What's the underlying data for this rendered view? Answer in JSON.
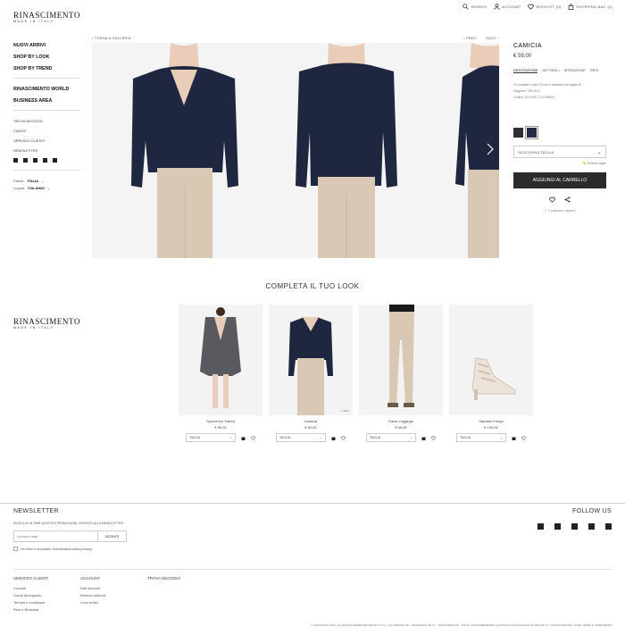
{
  "brand": {
    "name": "RINASCIMENTO",
    "tagline": "MADE IN ITALY"
  },
  "topnav": {
    "search": "SEARCH",
    "account": "ACCOUNT",
    "wishlist": "WISHLIST",
    "wishlist_count": "(0)",
    "bag": "SHOPPING BAG",
    "bag_count": "(0)"
  },
  "sidebar": {
    "primary": [
      "NUOVI ARRIVI",
      "SHOP BY LOOK",
      "SHOP BY TREND"
    ],
    "secondary": [
      "RINASCIMENTO WORLD",
      "BUSINESS AREA"
    ],
    "links": [
      "TROVA NEGOZIO",
      "CARDS",
      "SERVIZIO CLIENTI",
      "NEWSLETTER"
    ],
    "country_label": "Paese:",
    "country_value": "ITALIA",
    "language_label": "Lingua:",
    "language_value": "ITALIANO"
  },
  "gallery": {
    "back_link": "TORNA A GALLERIA",
    "prev": "PREC",
    "next": "SUCC"
  },
  "product": {
    "name": "CAMICIA",
    "price": "€ 59,00",
    "tabs": [
      "DESCRIZIONE",
      "DETTAGLI",
      "SPEDIZIONE",
      "RESI"
    ],
    "description": "La modella è alta 175 cm e indossa una taglia 42.",
    "season": "Stagione: FW 2017",
    "code": "Codice: CFC0017713 003814",
    "size_select": "SELEZIONA TAGLIA",
    "size_guide": "Schede taglie",
    "add_to_cart": "AGGIUNGI AL CARRELLO",
    "question": "Ti possiamo aiutare?",
    "colors": [
      "#2e2e33",
      "#232a45"
    ]
  },
  "look": {
    "title": "COMPLETA IL TUO LOOK",
    "size_label": "TAGLIA",
    "more_label": "+ VEDI",
    "items": [
      {
        "name": "Spolverino Tweed",
        "price": "€ 99,00"
      },
      {
        "name": "Camicia",
        "price": "€ 59,00"
      },
      {
        "name": "Pants Leggings",
        "price": "€ 69,00"
      },
      {
        "name": "Sandalo Pongo",
        "price": "€ 139,00"
      }
    ]
  },
  "footer": {
    "newsletter_title": "NEWSLETTER",
    "newsletter_text": "RICEVI LE ULTIME NOVITÀ E PROMOZIONI, ISCRIVITI ALLA NEWSLETTER",
    "email_placeholder": "La tua e-mail",
    "subscribe": "ISCRIVITI",
    "privacy": "Ho letto e accettato l'informativa sulla privacy",
    "follow_title": "FOLLOW US",
    "columns": [
      {
        "title": "SERVIZIO CLIENTI",
        "links": [
          "Contatti",
          "Guida all'acquisto",
          "Termini e condizioni",
          "Resi e Rimborsi"
        ]
      },
      {
        "title": "ACCOUNT",
        "links": [
          "Dati account",
          "Rubrica indirizzi",
          "I tuoi ordini"
        ]
      },
      {
        "title": "TROVA NEGOZIO",
        "links": []
      }
    ],
    "copyright": "© COPYRIGHT 2017 ALL RIGHTS RESERVED TEDDY S.P.A. | VIA CORIANO 58 - GROSSMALL BL 97 - 47924 RIMINI RN - ITALIA | P.IVA 00984390403 | CAPITALE SOCIALE EURO 50.000.000 I.V. | ISCRIZIONE REG. IMPR. RIMINI N. 00984390403"
  }
}
